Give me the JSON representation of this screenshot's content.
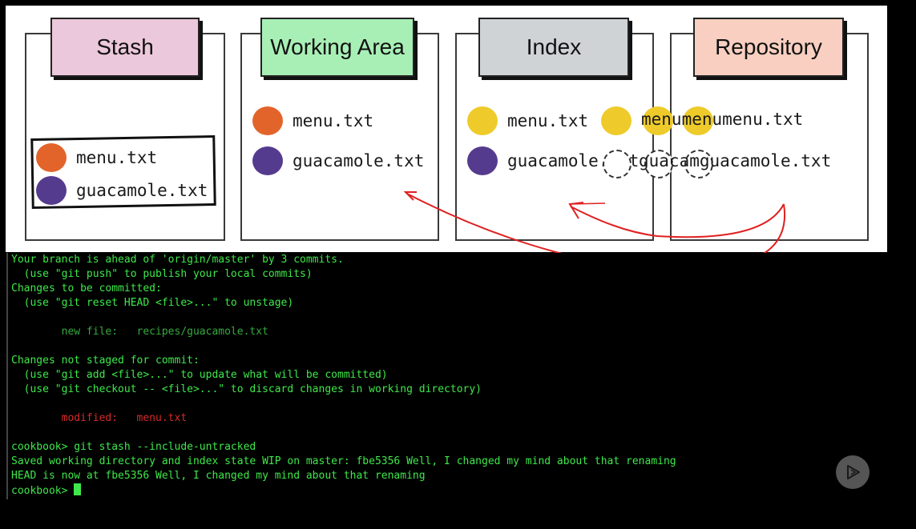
{
  "diagram": {
    "columns": [
      {
        "title": "Stash",
        "tab_color": "#ecc8dc"
      },
      {
        "title": "Working Area",
        "tab_color": "#a8efb6"
      },
      {
        "title": "Index",
        "tab_color": "#cfd3d6"
      },
      {
        "title": "Repository",
        "tab_color": "#f8cfc0"
      }
    ],
    "stash_files": [
      "menu.txt",
      "guacamole.txt"
    ],
    "working_files": [
      "menu.txt",
      "guacamole.txt"
    ],
    "index_files": [
      "menu.txt",
      "guacamole.txt"
    ],
    "repo_ghost_text": [
      "menumenumenu.txt",
      "guacamguacamole.txt"
    ],
    "blob_colors": {
      "orange": "#e2642a",
      "purple": "#553b8e",
      "yellow": "#eecb2a"
    },
    "arrow_color": "#e02020"
  },
  "terminal": {
    "lines": [
      "Your branch is ahead of 'origin/master' by 3 commits.",
      "  (use \"git push\" to publish your local commits)",
      "Changes to be committed:",
      "  (use \"git reset HEAD <file>...\" to unstage)",
      "",
      "        new file:   recipes/guacamole.txt",
      "",
      "Changes not staged for commit:",
      "  (use \"git add <file>...\" to update what will be committed)",
      "  (use \"git checkout -- <file>...\" to discard changes in working directory)",
      "",
      "        modified:   menu.txt",
      "",
      "cookbook> git stash --include-untracked",
      "Saved working directory and index state WIP on master: fbe5356 Well, I changed my mind about that renaming",
      "HEAD is now at fbe5356 Well, I changed my mind about that renaming",
      "cookbook> "
    ],
    "text_color": "#3ee84a",
    "modified_color": "#d62a2a"
  },
  "player": {
    "play_icon": "play-icon"
  }
}
